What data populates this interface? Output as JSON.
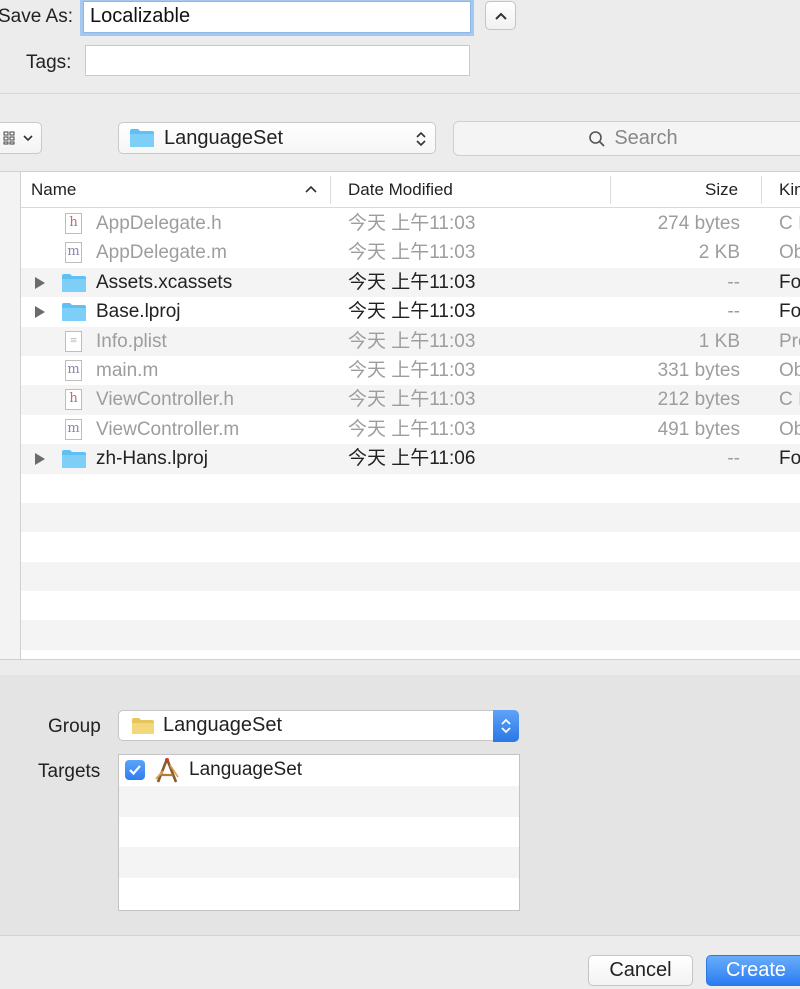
{
  "save": {
    "save_as_label": "Save As:",
    "save_as_value": "Localizable",
    "tags_label": "Tags:",
    "tags_value": ""
  },
  "toolbar": {
    "location": "LanguageSet",
    "search_placeholder": "Search"
  },
  "columns": {
    "name": "Name",
    "date_modified": "Date Modified",
    "size": "Size",
    "kind": "Kin"
  },
  "files": [
    {
      "name": "AppDelegate.h",
      "date": "今天 上午11:03",
      "size": "274 bytes",
      "kind": "C I",
      "icon": "h-file-icon",
      "state": "disabled"
    },
    {
      "name": "AppDelegate.m",
      "date": "今天 上午11:03",
      "size": "2 KB",
      "kind": "Ob",
      "icon": "m-file-icon",
      "state": "disabled"
    },
    {
      "name": "Assets.xcassets",
      "date": "今天 上午11:03",
      "size": "--",
      "kind": "Fo",
      "icon": "folder-icon",
      "state": "enabled"
    },
    {
      "name": "Base.lproj",
      "date": "今天 上午11:03",
      "size": "--",
      "kind": "Fo",
      "icon": "folder-icon",
      "state": "enabled"
    },
    {
      "name": "Info.plist",
      "date": "今天 上午11:03",
      "size": "1 KB",
      "kind": "Pro",
      "icon": "plist-file-icon",
      "state": "disabled"
    },
    {
      "name": "main.m",
      "date": "今天 上午11:03",
      "size": "331 bytes",
      "kind": "Ob",
      "icon": "m-file-icon",
      "state": "disabled"
    },
    {
      "name": "ViewController.h",
      "date": "今天 上午11:03",
      "size": "212 bytes",
      "kind": "C I",
      "icon": "h-file-icon",
      "state": "disabled"
    },
    {
      "name": "ViewController.m",
      "date": "今天 上午11:03",
      "size": "491 bytes",
      "kind": "Ob",
      "icon": "m-file-icon",
      "state": "disabled"
    },
    {
      "name": "zh-Hans.lproj",
      "date": "今天 上午11:06",
      "size": "--",
      "kind": "Fo",
      "icon": "folder-icon",
      "state": "enabled"
    }
  ],
  "options": {
    "group_label": "Group",
    "group_value": "LanguageSet",
    "targets_label": "Targets",
    "targets": [
      {
        "name": "LanguageSet",
        "checked": true
      }
    ]
  },
  "footer": {
    "cancel_label": "Cancel",
    "create_label": "Create"
  },
  "colors": {
    "accent": "#2b7cf0",
    "folder_blue": "#5ec0f5",
    "group_folder": "#f3d77a"
  }
}
